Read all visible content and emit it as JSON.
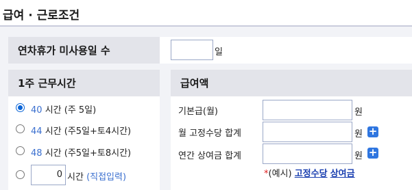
{
  "page": {
    "title": "급여 · 근로조건"
  },
  "leave": {
    "header": "연차휴가 미사용일 수",
    "value": "",
    "unit": "일"
  },
  "hours": {
    "header": "1주 근무시간",
    "options": [
      {
        "num": "40",
        "unit": "시간",
        "desc": "(주 5일)",
        "checked": true
      },
      {
        "num": "44",
        "unit": "시간",
        "desc": "(주5일+토4시간)",
        "checked": false
      },
      {
        "num": "48",
        "unit": "시간",
        "desc": "(주5일+토8시간)",
        "checked": false
      }
    ],
    "custom": {
      "value": "0",
      "unit": "시간",
      "desc": "(직접입력)"
    }
  },
  "pay": {
    "header": "급여액",
    "rows": [
      {
        "label": "기본급(월)",
        "value": "",
        "unit": "원"
      },
      {
        "label": "월 고정수당 합계",
        "value": "",
        "unit": "원"
      },
      {
        "label": "연간 상여금 합계",
        "value": "",
        "unit": "원"
      }
    ],
    "add_label": "+",
    "note": {
      "star": "*",
      "prefix": "(예시)",
      "link1": "고정수당",
      "link2": "상여금"
    }
  },
  "colors": {
    "header_bg": "#e3e4ea",
    "frame_bg": "#f2f3f7",
    "accent_blue": "#3a6fcf",
    "plus_button": "#2f76e0",
    "link": "#1a3fb0",
    "required_star": "#e02020"
  }
}
